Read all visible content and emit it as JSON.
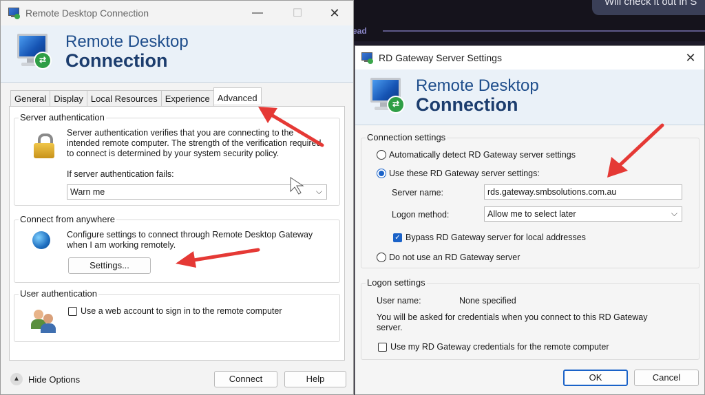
{
  "background": {
    "chat_bubble": "Will check it out in S",
    "read_label": "ead"
  },
  "main_window": {
    "title": "Remote Desktop Connection",
    "banner_line1": "Remote Desktop",
    "banner_line2": "Connection",
    "tabs": [
      {
        "label": "General"
      },
      {
        "label": "Display"
      },
      {
        "label": "Local Resources"
      },
      {
        "label": "Experience"
      },
      {
        "label": "Advanced",
        "active": true
      }
    ],
    "server_auth": {
      "title": "Server authentication",
      "description": "Server authentication verifies that you are connecting to the\nintended remote computer. The strength of the verification required\nto connect is determined by your system security policy.",
      "fail_label": "If server authentication fails:",
      "fail_value": "Warn me"
    },
    "anywhere": {
      "title": "Connect from anywhere",
      "description": "Configure settings to connect through Remote Desktop Gateway\nwhen I am working remotely.",
      "settings_button": "Settings..."
    },
    "user_auth": {
      "title": "User authentication",
      "checkbox_label": "Use a web account to sign in to the remote computer",
      "checked": false
    },
    "footer": {
      "hide_options": "Hide Options",
      "connect": "Connect",
      "help": "Help"
    }
  },
  "gateway_dialog": {
    "title": "RD Gateway Server Settings",
    "banner_line1": "Remote Desktop",
    "banner_line2": "Connection",
    "connection_settings": {
      "title": "Connection settings",
      "radio_auto": "Automatically detect RD Gateway server settings",
      "radio_use": "Use these RD Gateway server settings:",
      "server_name_label": "Server name:",
      "server_name_value": "rds.gateway.smbsolutions.com.au",
      "logon_method_label": "Logon method:",
      "logon_method_value": "Allow me to select later",
      "bypass_label": "Bypass RD Gateway server for local addresses",
      "bypass_checked": true,
      "radio_none": "Do not use an RD Gateway server",
      "selected": "use"
    },
    "logon_settings": {
      "title": "Logon settings",
      "user_name_label": "User name:",
      "user_name_value": "None specified",
      "info": "You will be asked for credentials when you connect to this RD Gateway\nserver.",
      "use_creds_label": "Use my RD Gateway credentials for the remote computer",
      "use_creds_checked": false
    },
    "ok": "OK",
    "cancel": "Cancel"
  },
  "icons": {
    "app": "remote-desktop-icon",
    "lock": "lock-icon",
    "globe": "gateway-globe-icon",
    "users": "users-icon",
    "close": "close-icon",
    "minimize": "minimize-icon",
    "maximize": "maximize-icon",
    "chevron": "chevron-down-icon",
    "collapse": "chevron-up-circle-icon"
  },
  "colors": {
    "accent": "#1a62c8",
    "annotation_arrow": "#e53935",
    "banner_text": "#1f4e8c"
  }
}
